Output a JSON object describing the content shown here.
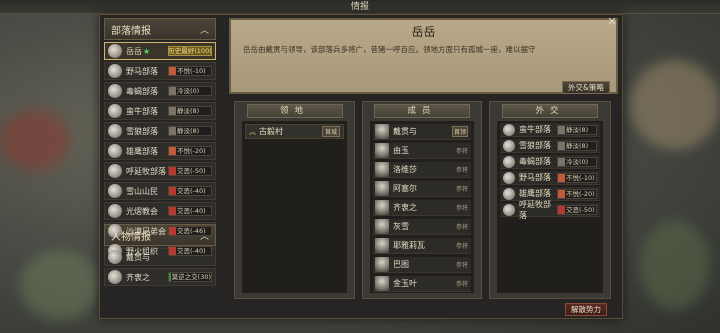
{
  "window_title": "情报",
  "tribe_section": {
    "title": "部落情报",
    "tribes": [
      {
        "name": "岳岳",
        "star": "★",
        "relation": "历史最好(100)",
        "style": "gold",
        "selected": true,
        "color": "#6b5a1f"
      },
      {
        "name": "野马部落",
        "relation": "不悦(-10)",
        "color": "#c25a3a"
      },
      {
        "name": "毒蝎部落",
        "relation": "冷淡(0)",
        "color": "#7a7366"
      },
      {
        "name": "蛮牛部落",
        "relation": "静淡(8)",
        "color": "#7a7366"
      },
      {
        "name": "雪狼部落",
        "relation": "静淡(8)",
        "color": "#7a7366"
      },
      {
        "name": "雄鹰部落",
        "relation": "不悦(-20)",
        "color": "#c25a3a"
      },
      {
        "name": "呼延牧部落",
        "relation": "交恶(-50)",
        "color": "#b8392f"
      },
      {
        "name": "雪山山民",
        "relation": "交恶(-40)",
        "color": "#b8392f"
      },
      {
        "name": "光熠教会",
        "relation": "交恶(-40)",
        "color": "#b8392f"
      },
      {
        "name": "沙漠兄弟会",
        "relation": "交恶(-46)",
        "color": "#b8392f"
      },
      {
        "name": "野火组织",
        "relation": "交恶(-40)",
        "color": "#b8392f"
      }
    ]
  },
  "people_section": {
    "title": "人物情报",
    "people": [
      {
        "name": "戴贯与",
        "relation": ""
      },
      {
        "name": "齐衷之",
        "relation": "莫逆之交(30)",
        "color": "#3f8f3f"
      }
    ]
  },
  "banner": {
    "title": "岳岳",
    "description": "岳岳由戴贯与领导，该部落兵多将广，昔猪一呼百应。领地方面只有孤城一座，难以据守",
    "button": "外交&策略"
  },
  "territory": {
    "header": "领地",
    "items": [
      {
        "name": "古毅村",
        "tag": "首城"
      }
    ]
  },
  "members": {
    "header": "成员",
    "items": [
      {
        "name": "戴贯与",
        "role": "首领",
        "boxed": true
      },
      {
        "name": "由玉",
        "role": "参将"
      },
      {
        "name": "洛维莎",
        "role": "参将"
      },
      {
        "name": "阿塞尔",
        "role": "参将"
      },
      {
        "name": "齐衷之",
        "role": "参将"
      },
      {
        "name": "灰雪",
        "role": "参将"
      },
      {
        "name": "耶雅莉瓦",
        "role": "参将"
      },
      {
        "name": "巴图",
        "role": "参将"
      },
      {
        "name": "金玉叶",
        "role": "参将"
      }
    ]
  },
  "diplomacy": {
    "header": "外交",
    "items": [
      {
        "name": "蛮牛部落",
        "relation": "静淡(8)",
        "color": "#7a7366"
      },
      {
        "name": "雪狼部落",
        "relation": "静淡(8)",
        "color": "#7a7366"
      },
      {
        "name": "毒蝎部落",
        "relation": "冷淡(0)",
        "color": "#7a7366"
      },
      {
        "name": "野马部落",
        "relation": "不悦(-10)",
        "color": "#c25a3a"
      },
      {
        "name": "雄鹰部落",
        "relation": "不悦(-20)",
        "color": "#c25a3a"
      },
      {
        "name": "呼延牧部落",
        "relation": "交恶(-50)",
        "color": "#b8392f"
      }
    ]
  },
  "disband_button": "解散势力",
  "close_icon": "close-icon"
}
